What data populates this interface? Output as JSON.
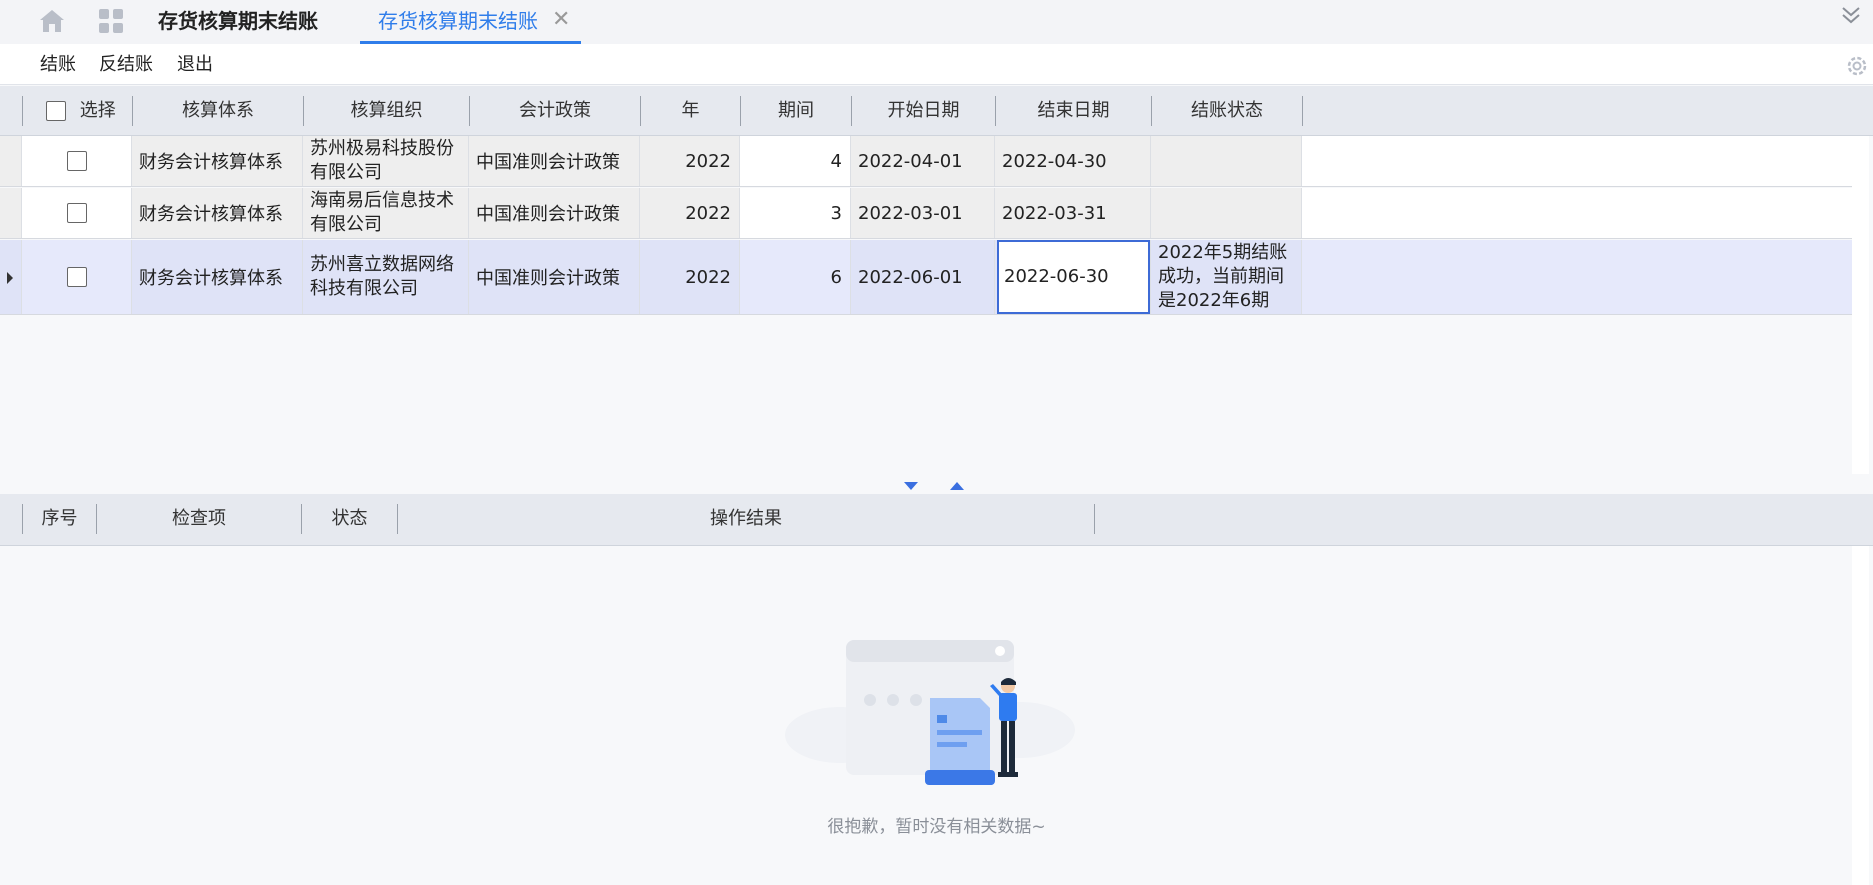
{
  "tabs": {
    "home_tab_label": "存货核算期末结账",
    "active_tab_label": "存货核算期末结账",
    "close_symbol": "✕"
  },
  "toolbar": {
    "close_label": "结账",
    "reverse_label": "反结账",
    "exit_label": "退出"
  },
  "grid": {
    "columns": [
      "选择",
      "核算体系",
      "核算组织",
      "会计政策",
      "年",
      "期间",
      "开始日期",
      "结束日期",
      "结账状态"
    ],
    "rows": [
      {
        "system": "财务会计核算体系",
        "org": "苏州极易科技股份有限公司",
        "policy": "中国准则会计政策",
        "year": "2022",
        "period": "4",
        "start": "2022-04-01",
        "end": "2022-04-30",
        "status": ""
      },
      {
        "system": "财务会计核算体系",
        "org": "海南易后信息技术有限公司",
        "policy": "中国准则会计政策",
        "year": "2022",
        "period": "3",
        "start": "2022-03-01",
        "end": "2022-03-31",
        "status": ""
      },
      {
        "system": "财务会计核算体系",
        "org": "苏州喜立数据网络科技有限公司",
        "policy": "中国准则会计政策",
        "year": "2022",
        "period": "6",
        "start": "2022-06-01",
        "end": "2022-06-30",
        "status": "2022年5期结账成功，当前期间是2022年6期"
      }
    ],
    "selected_row": 3
  },
  "result_grid": {
    "columns": [
      "序号",
      "检查项",
      "状态",
      "操作结果"
    ],
    "empty_text": "很抱歉，暂时没有相关数据~"
  },
  "colors": {
    "accent": "#2f7dea",
    "selected_row": "#dfe3f7"
  }
}
